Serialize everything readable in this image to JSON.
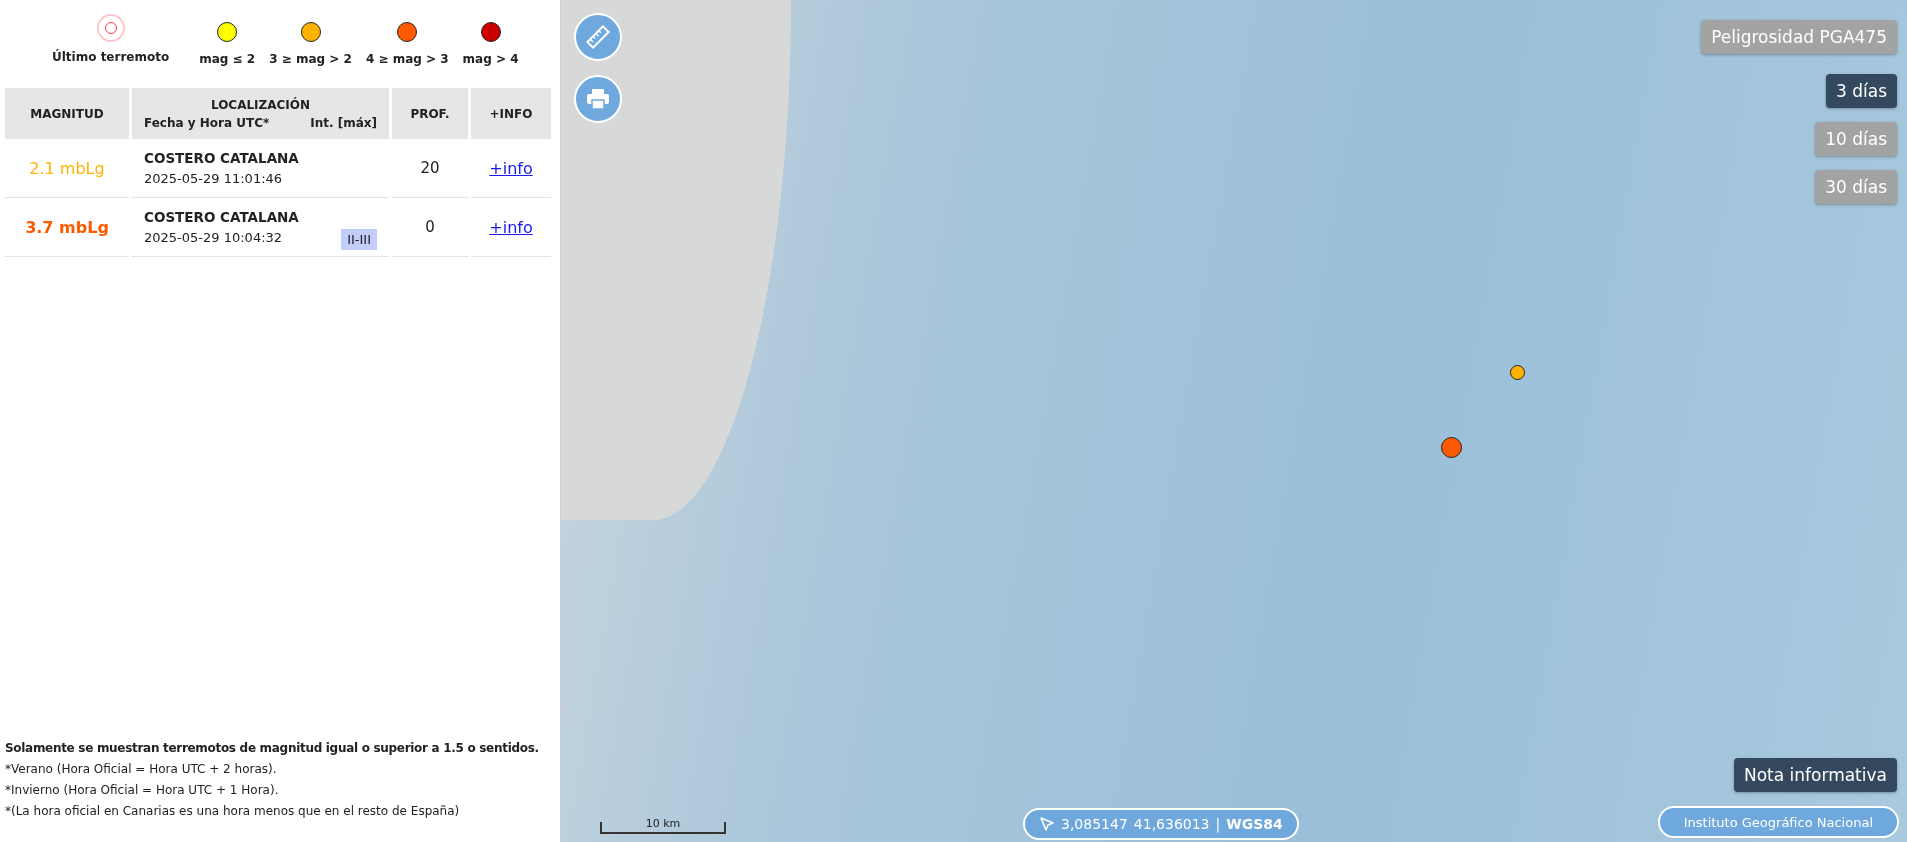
{
  "legend": {
    "last": {
      "label": "Último terremoto"
    },
    "levels": [
      {
        "label": "mag ≤ 2",
        "color": "#ffff00"
      },
      {
        "label": "3 ≥ mag > 2",
        "color": "#ffb300"
      },
      {
        "label": "4 ≥ mag > 3",
        "color": "#ff5a00"
      },
      {
        "label": "mag > 4",
        "color": "#cc0000"
      }
    ]
  },
  "table": {
    "columns": {
      "magnitude": "MAGNITUD",
      "location": "LOCALIZACIÓN",
      "datetime": "Fecha y Hora UTC*",
      "intensity": "Int. [máx]",
      "depth": "PROF.",
      "info": "+INFO"
    },
    "rows": [
      {
        "magnitude": "2.1 mbLg",
        "color": "#ffb300",
        "bold": false,
        "location": "COSTERO CATALANA",
        "datetime": "2025-05-29 11:01:46",
        "depth": "20",
        "info": "+info"
      },
      {
        "magnitude": "3.7 mbLg",
        "color": "#ff5a00",
        "bold": true,
        "location": "COSTERO CATALANA",
        "datetime": "2025-05-29 10:04:32",
        "intensity": "II-III",
        "depth": "0",
        "info": "+info"
      }
    ]
  },
  "notes": [
    "Solamente se muestran terremotos de magnitud igual o superior a 1.5 o sentidos.",
    "*Verano (Hora Oficial = Hora UTC + 2 horas).",
    "*Invierno (Hora Oficial = Hora UTC + 1 Hora).",
    "*(La hora oficial en Canarias es una hora menos que en el resto de España)"
  ],
  "map": {
    "markers": [
      {
        "color": "#ffb300"
      },
      {
        "color": "#ff5a00"
      }
    ],
    "hazard_button": "Peligrosidad PGA475",
    "periods": [
      {
        "label": "3 días",
        "selected": true
      },
      {
        "label": "10 días",
        "selected": false
      },
      {
        "label": "30 días",
        "selected": false
      }
    ],
    "note_button": "Nota informativa",
    "scale": "10 km",
    "coords": {
      "lon": "3,085147",
      "lat": "41,636013",
      "separator": "|",
      "crs": "WGS84"
    },
    "attribution": "Instituto Geográfico Nacional"
  }
}
